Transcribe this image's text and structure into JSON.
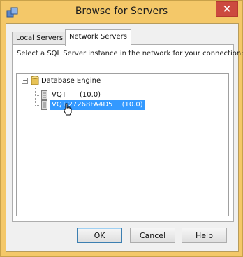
{
  "window": {
    "title": "Browse for Servers",
    "close_glyph": "×"
  },
  "tabs": [
    {
      "label": "Local Servers",
      "active": false
    },
    {
      "label": "Network Servers",
      "active": true
    }
  ],
  "instructions": "Select a SQL Server instance in the network for your connection:",
  "tree": {
    "root": {
      "label": "Database Engine",
      "expander": "−",
      "icon": "database-icon"
    },
    "items": [
      {
        "name": "VQT",
        "version": "(10.0)",
        "selected": false,
        "icon": "server-icon"
      },
      {
        "name": "VQT-27268FA4D5",
        "version": "(10.0)",
        "selected": true,
        "icon": "server-icon"
      }
    ]
  },
  "buttons": {
    "ok": "OK",
    "cancel": "Cancel",
    "help": "Help"
  },
  "colors": {
    "frame": "#f4c869",
    "selection": "#3399ff",
    "close": "#cc4a3f"
  }
}
